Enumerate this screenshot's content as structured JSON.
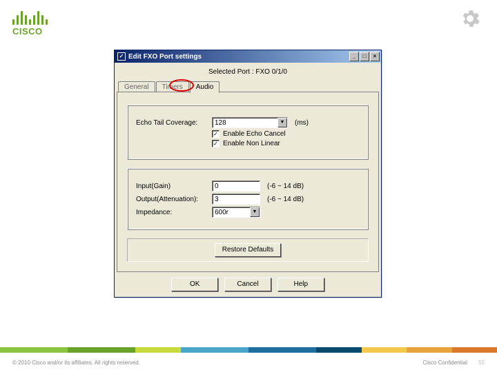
{
  "logo": {
    "text": "CISCO"
  },
  "dialog": {
    "title": "Edit FXO Port settings",
    "selected_port_label": "Selected Port :",
    "selected_port_value": "FXO 0/1/0",
    "tabs": {
      "general": "General",
      "timers": "Timers",
      "audio": "Audio"
    },
    "echo": {
      "tail_label": "Echo Tail Coverage:",
      "tail_value": "128",
      "tail_unit": "(ms)",
      "enable_cancel": "Enable Echo Cancel",
      "enable_nonlinear": "Enable Non Linear"
    },
    "gain": {
      "input_label": "Input(Gain)",
      "input_value": "0",
      "input_range": "(-6 ~ 14 dB)",
      "output_label": "Output(Attenuation):",
      "output_value": "3",
      "output_range": "(-6 ~ 14 dB)",
      "impedance_label": "Impedance:",
      "impedance_value": "600r"
    },
    "buttons": {
      "restore": "Restore Defaults",
      "ok": "OK",
      "cancel": "Cancel",
      "help": "Help"
    },
    "checkmark": "✓"
  },
  "footer": {
    "copyright": "© 2010 Cisco and/or its affiliates. All rights reserved.",
    "confidential": "Cisco Confidential",
    "page": "55"
  },
  "colors": {
    "bar": [
      "#8bc53f",
      "#6aa329",
      "#c8d93b",
      "#4aa6c9",
      "#1e6f9e",
      "#064a6e",
      "#f2c94c",
      "#e8a33d",
      "#d9782a"
    ]
  }
}
